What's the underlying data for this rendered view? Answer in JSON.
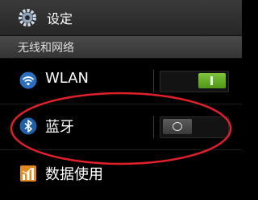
{
  "header": {
    "title": "设定",
    "icon": "gear-icon"
  },
  "section": {
    "title": "无线和网络"
  },
  "rows": [
    {
      "label": "WLAN",
      "icon": "wifi-icon",
      "toggle": "on",
      "toggle_symbol": "I"
    },
    {
      "label": "蓝牙",
      "icon": "bluetooth-icon",
      "toggle": "off",
      "toggle_symbol": "O"
    },
    {
      "label": "数据使用",
      "icon": "data-usage-icon"
    }
  ],
  "colors": {
    "accent_on": "#6db32e",
    "annotation": "#e0202a"
  }
}
